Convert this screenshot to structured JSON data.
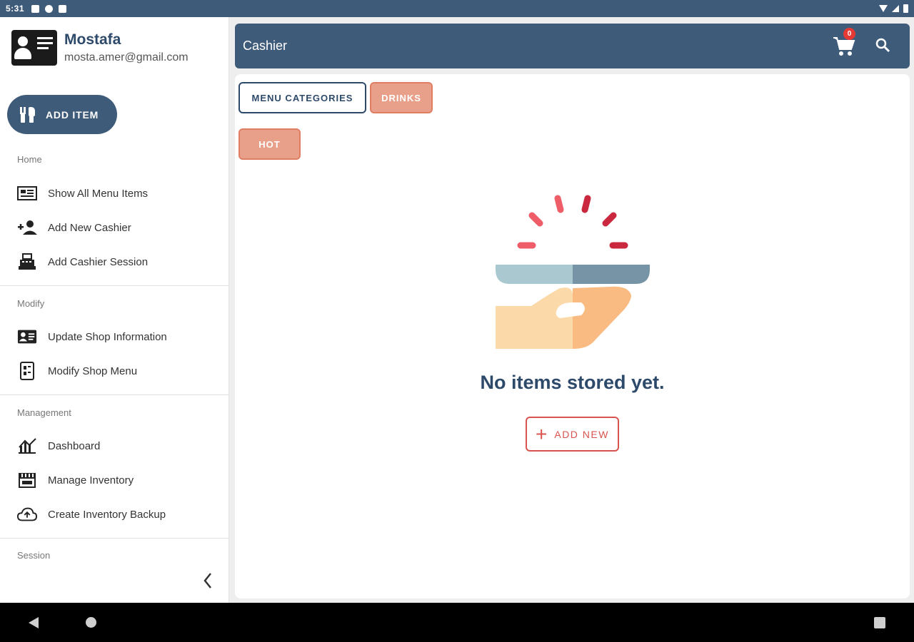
{
  "status_bar": {
    "time": "5:31"
  },
  "profile": {
    "name": "Mostafa",
    "email": "mosta.amer@gmail.com"
  },
  "sidebar": {
    "add_item_label": "ADD ITEM",
    "sections": {
      "home": "Home",
      "modify": "Modify",
      "management": "Management",
      "session": "Session"
    },
    "items": [
      {
        "label": "Show All Menu Items",
        "icon": "menu-list-icon"
      },
      {
        "label": "Add New Cashier",
        "icon": "add-person-icon"
      },
      {
        "label": "Add Cashier Session",
        "icon": "cash-register-icon"
      },
      {
        "label": "Update Shop Information",
        "icon": "id-card-icon"
      },
      {
        "label": "Modify Shop Menu",
        "icon": "menu-book-icon"
      },
      {
        "label": "Dashboard",
        "icon": "chart-icon"
      },
      {
        "label": "Manage Inventory",
        "icon": "store-icon"
      },
      {
        "label": "Create Inventory Backup",
        "icon": "cloud-upload-icon"
      }
    ]
  },
  "appbar": {
    "title": "Cashier",
    "cart_count": "0"
  },
  "chips": {
    "menu_categories": "MENU CATEGORIES",
    "drinks": "DRINKS",
    "hot": "HOT"
  },
  "empty_state": {
    "message": "No items stored yet.",
    "add_new_label": "ADD NEW"
  },
  "colors": {
    "primary": "#3f5b7a",
    "accent_chip": "#e9a08a",
    "danger": "#d9534f"
  }
}
